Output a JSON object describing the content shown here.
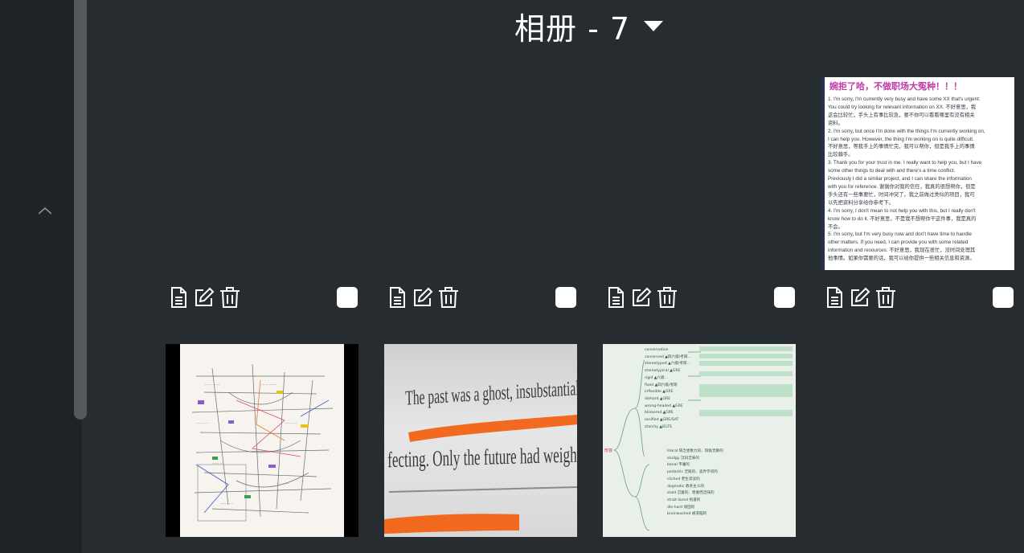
{
  "album": {
    "title": "相册 - 7"
  },
  "thumbnails": [
    {
      "kind": "document",
      "title": "婉拒了哈，不做职场大冤种！！！",
      "lines": [
        "1.  I'm sorry, I'm currently very busy and have some XX that's urgent.",
        "     You could try looking for relevant information on XX. 不好意思，我",
        "     这会比较忙，手头上有事比较急，要不你可以看看哪里有没有相关",
        "     资料。",
        "2.  I'm sorry, but once I'm done with the things I'm currently working on,",
        "     I can help you. However, the thing I'm working on is quite difficult.",
        "     不好意思，等我手上的事情忙完，我可以帮你，但是我手上的事情",
        "     比较棘手。",
        "3.  Thank you for your trust in me. I really want to help you, but I have",
        "     some other things to deal with and there's a time conflict.",
        "     Previously I did a similar project, and I can share the information",
        "     with you for reference. 谢谢你对我的信任，我真的很想帮你，但是",
        "     手头还有一些事要忙，时间冲突了。我之前做过类似的项目，我可",
        "     以先把资料分享给你参考下。",
        "4.  I'm sorry, I don't mean to not help you with this, but I really don't",
        "     know how to do it. 不好意思，不是我不想帮你干这件事，我是真的",
        "     不会。",
        "5.  I'm sorry, but I'm very busy now and don't have time to handle",
        "     other matters. If you need, I can provide you with some related",
        "     information and resources. 不好意思，我现在很忙，没时间处理其",
        "     他事情。如果你需要的话，我可以给你提供一些相关信息和资源。"
      ]
    },
    {
      "kind": "mindmap"
    },
    {
      "kind": "quote",
      "line1": "The past was a ghost, insubstantial, unaf-",
      "line2": "fecting. Only the future had weight."
    },
    {
      "kind": "vocabulary",
      "root": "形容",
      "nodes": [
        "conservative",
        "conserved ▲四六级/考研...",
        "stereotyped ▲六级/考研...",
        "stereotypical ▲GRE",
        "rigid ▲六级...",
        "fixed ▲四六级/考研",
        "inflexible ▲GRE",
        "diehard ▲GRE",
        "wrong-headed ▲GRE",
        "blinkered ▲GRE",
        "ossified ▲GRE/SAT",
        "starchy ▲IELTS",
        "literal 缺乏想象力的、刻板无聊的",
        "stodgy 沉闷乏味的",
        "banal 平庸的",
        "pedantic 迂腐的、卖弄学问的",
        "cliched 老生常谈的",
        "dogmatic 教条主义的",
        "staid 沉着的、稳重而乏味的",
        "strait-laced 拘谨的",
        "die-hard 顽固的",
        "brainwashed 被洗脑的"
      ]
    }
  ],
  "toolbar": {
    "icons": [
      "document-icon",
      "edit-icon",
      "trash-icon"
    ]
  },
  "colors": {
    "background": "#262c30",
    "sidebar": "#1f2226",
    "scrollbar": "#55585c",
    "accent_orange": "#f26a1f",
    "doc_title": "#c03aa6"
  }
}
